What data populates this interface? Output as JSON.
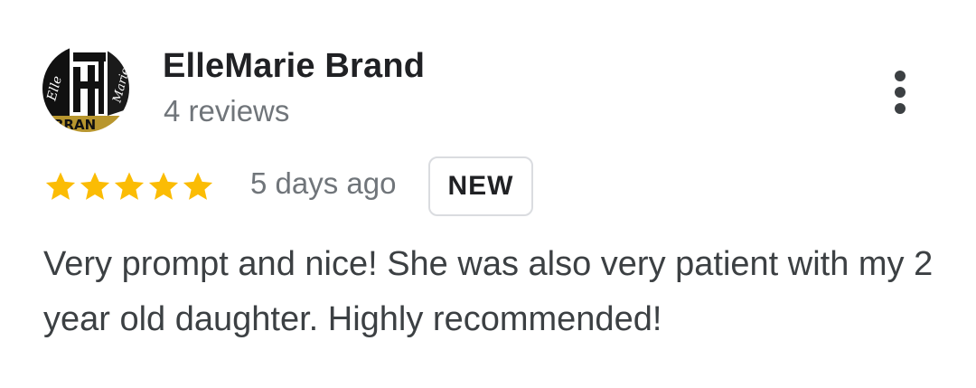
{
  "review": {
    "reviewer_name": "ElleMarie Brand",
    "review_count": "4 reviews",
    "avatar_icon": "ellemarie-brand-logo-avatar",
    "avatar_logo_text": [
      "L'Elle",
      "Marie",
      "BRAND"
    ],
    "rating": 5,
    "rating_max": 5,
    "star_color": "#fbbc04",
    "date": "5 days ago",
    "badge": "NEW",
    "text": "Very prompt and nice! She was also very patient with my 2 year old daughter. Highly recommended!",
    "more_icon": "more-vertical-icon"
  }
}
